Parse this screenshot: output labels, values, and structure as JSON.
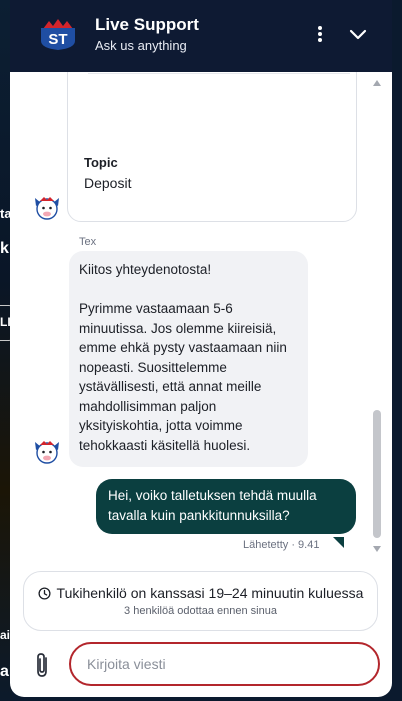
{
  "background_page": {
    "fragments": [
      "ta",
      "k",
      "LIS",
      "ain",
      "ais"
    ]
  },
  "header": {
    "logo_text": "ST",
    "title": "Live Support",
    "subtitle": "Ask us anything",
    "menu_icon": "vertical-ellipsis-icon",
    "collapse_icon": "chevron-down-icon",
    "colors": {
      "background": "#0e1a33",
      "logo_blue": "#1f4ea3",
      "logo_red": "#d3242c"
    }
  },
  "chat": {
    "form_card": {
      "topic_label": "Topic",
      "topic_value": "Deposit"
    },
    "agent_name": "Tex",
    "agent_message": [
      "Kiitos yhteydenotosta!",
      "Pyrimme vastaamaan 5-6 minuutissa. Jos olemme kiireisiä, emme ehkä pysty vastaamaan niin nopeasti. Suosittelemme ystävällisesti, että annat meille mahdollisimman paljon yksityiskohtia, jotta voimme tehokkaasti käsitellä huolesi."
    ],
    "user_message": "Hei, voiko talletuksen tehdä muulla tavalla kuin pankkitunnuksilla?",
    "user_message_status": "Lähetetty · 9.41",
    "colors": {
      "user_bubble": "#0b3f40",
      "agent_bubble": "#f1f2f5"
    }
  },
  "queue": {
    "line": "Tukihenkilö on kanssasi 19–24 minuutin kuluessa",
    "sub": "3 henkilöä odottaa ennen sinua",
    "icon": "clock-icon"
  },
  "composer": {
    "placeholder": "Kirjoita viesti",
    "value": "",
    "attach_icon": "paperclip-icon",
    "border_color": "#b3262c"
  }
}
